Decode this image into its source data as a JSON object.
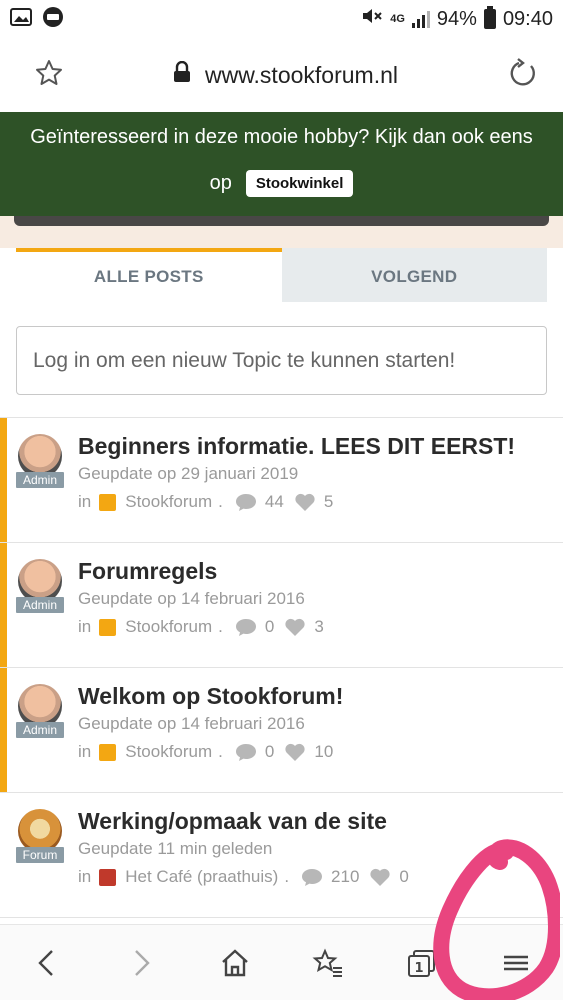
{
  "status": {
    "network": "4G",
    "battery": "94%",
    "time": "09:40"
  },
  "browser": {
    "url": "www.stookforum.nl"
  },
  "banner": {
    "text_line1": "Geïnteresseerd in deze mooie hobby? Kijk dan ook eens",
    "text_line2": "op",
    "button_label": "Stookwinkel",
    "color": "#2e5227"
  },
  "tabs": [
    {
      "label": "ALLE POSTS",
      "active": true
    },
    {
      "label": "VOLGEND",
      "active": false
    }
  ],
  "new_topic": {
    "placeholder": "Log in om een nieuw Topic te kunnen starten!"
  },
  "posts": [
    {
      "title": "Beginners informatie. LEES DIT EERST!",
      "updated": "Geupdate op 29 januari 2019",
      "role": "Admin",
      "in_label": "in",
      "category": "Stookforum",
      "category_color": "#f3a712",
      "separator": ".",
      "comments": "44",
      "likes": "5",
      "pinned": true
    },
    {
      "title": "Forumregels",
      "updated": "Geupdate op 14 februari 2016",
      "role": "Admin",
      "in_label": "in",
      "category": "Stookforum",
      "category_color": "#f3a712",
      "separator": ".",
      "comments": "0",
      "likes": "3",
      "pinned": true
    },
    {
      "title": "Welkom op Stookforum!",
      "updated": "Geupdate op 14 februari 2016",
      "role": "Admin",
      "in_label": "in",
      "category": "Stookforum",
      "category_color": "#f3a712",
      "separator": ".",
      "comments": "0",
      "likes": "10",
      "pinned": true
    },
    {
      "title": "Werking/opmaak van de site",
      "updated": "Geupdate 11 min geleden",
      "role": "Forum",
      "in_label": "in",
      "category": "Het Café (praathuis)",
      "category_color": "#c0392b",
      "separator": ".",
      "comments": "210",
      "likes": "0",
      "pinned": false
    }
  ],
  "bottom_nav": {
    "tab_count": "1"
  },
  "colors": {
    "accent": "#f3a712",
    "annotation": "#e9457f"
  }
}
